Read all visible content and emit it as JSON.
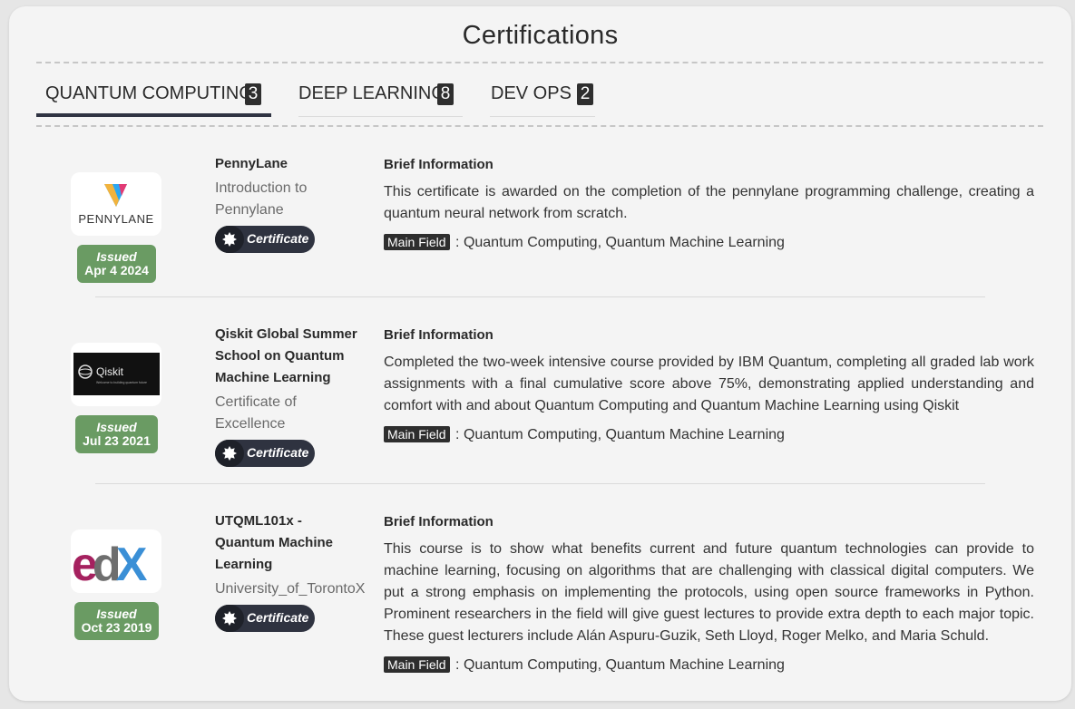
{
  "page": {
    "title": "Certifications"
  },
  "tabs": [
    {
      "label": "QUANTUM COMPUTING",
      "count": "3",
      "active": true
    },
    {
      "label": "DEEP LEARNING",
      "count": "8",
      "active": false
    },
    {
      "label": "DEV OPS",
      "count": "2",
      "active": false
    }
  ],
  "certificates": [
    {
      "logo_text": "PENNYLANE",
      "issued_label": "Issued",
      "issued_date": "Apr 4 2024",
      "name": "PennyLane",
      "subtitle": "Introduction to Pennylane",
      "button_label": "Certificate",
      "brief_heading": "Brief Information",
      "brief": "This certificate is awarded on the completion of the pennylane programming challenge, creating a quantum neural network from scratch.",
      "field_label": "Main Field",
      "field_value": ": Quantum Computing, Quantum Machine Learning"
    },
    {
      "logo_text": "Qiskit",
      "logo_tagline": "Welcome to building quantum future",
      "issued_label": "Issued",
      "issued_date": "Jul 23 2021",
      "name": "Qiskit Global Summer School on Quantum Machine Learning",
      "subtitle": "Certificate of Excellence",
      "button_label": "Certificate",
      "brief_heading": "Brief Information",
      "brief": "Completed the two-week intensive course provided by IBM Quantum, completing all graded lab work assignments with a final cumulative score above 75%, demonstrating applied understanding and comfort with and about Quantum Computing and Quantum Machine Learning using Qiskit",
      "field_label": "Main Field",
      "field_value": ": Quantum Computing, Quantum Machine Learning"
    },
    {
      "logo_text": "edX",
      "issued_label": "Issued",
      "issued_date": "Oct 23 2019",
      "name": "UTQML101x - Quantum Machine Learning",
      "subtitle": "University_of_TorontoX",
      "button_label": "Certificate",
      "brief_heading": "Brief Information",
      "brief": "This course is to show what benefits current and future quantum technologies can provide to machine learning, focusing on algorithms that are challenging with classical digital computers. We put a strong emphasis on implementing the protocols, using open source frameworks in Python. Prominent researchers in the field will give guest lectures to provide extra depth to each major topic. These guest lecturers include Alán Aspuru-Guzik, Seth Lloyd, Roger Melko, and Maria Schuld.",
      "field_label": "Main Field",
      "field_value": ": Quantum Computing, Quantum Machine Learning"
    }
  ],
  "colors": {
    "issued_badge": "#6a9b63",
    "certificate_button": "#2f3340",
    "tab_underline": "#2f3342",
    "count_badge": "#2e2e2e"
  }
}
